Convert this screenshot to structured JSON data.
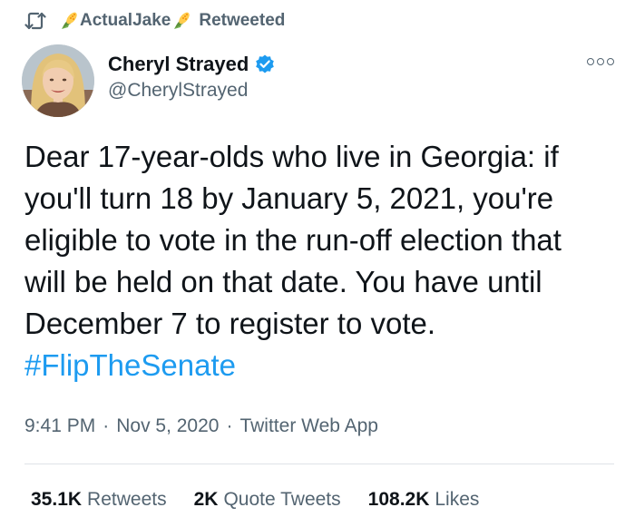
{
  "retweet": {
    "user": "ActualJake",
    "suffix": "Retweeted",
    "icon": "retweet-icon",
    "emoji_icon": "corn-icon"
  },
  "author": {
    "display_name": "Cheryl Strayed",
    "handle": "@CherylStrayed",
    "verified_icon": "verified-badge-icon"
  },
  "tweet": {
    "lines": [
      "Dear 17-year-olds who live in Georgia: if",
      "you'll turn 18 by January 5, 2021, you're",
      "eligible to vote in the run-off election that",
      "will be held on that date. You have until",
      "December 7 to register to vote."
    ],
    "hashtag": "#FlipTheSenate"
  },
  "meta": {
    "time": "9:41 PM",
    "date": "Nov 5, 2020",
    "source": "Twitter Web App",
    "separator": "·"
  },
  "stats": {
    "retweets_count": "35.1K",
    "retweets_label": "Retweets",
    "quotes_count": "2K",
    "quotes_label": "Quote Tweets",
    "likes_count": "108.2K",
    "likes_label": "Likes"
  },
  "colors": {
    "text": "#0f1419",
    "secondary": "#536471",
    "link": "#1d9bf0",
    "verified": "#1d9bf0",
    "divider": "#dfe3e7"
  }
}
